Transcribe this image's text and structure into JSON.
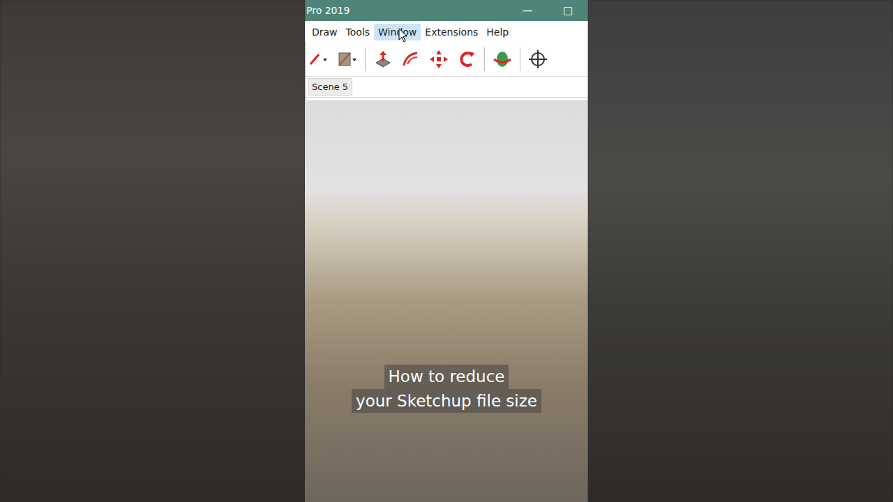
{
  "window": {
    "title": "Pro 2019",
    "controls": [
      "—",
      "□"
    ]
  },
  "menu": [
    {
      "label": "Draw",
      "selected": false
    },
    {
      "label": "Tools",
      "selected": false
    },
    {
      "label": "Window",
      "selected": true
    },
    {
      "label": "Extensions",
      "selected": false
    },
    {
      "label": "Help",
      "selected": false
    }
  ],
  "scenes": [
    {
      "label": "Scene 5",
      "selected": true
    }
  ],
  "caption": [
    "How to reduce",
    "your Sketchup file size"
  ]
}
